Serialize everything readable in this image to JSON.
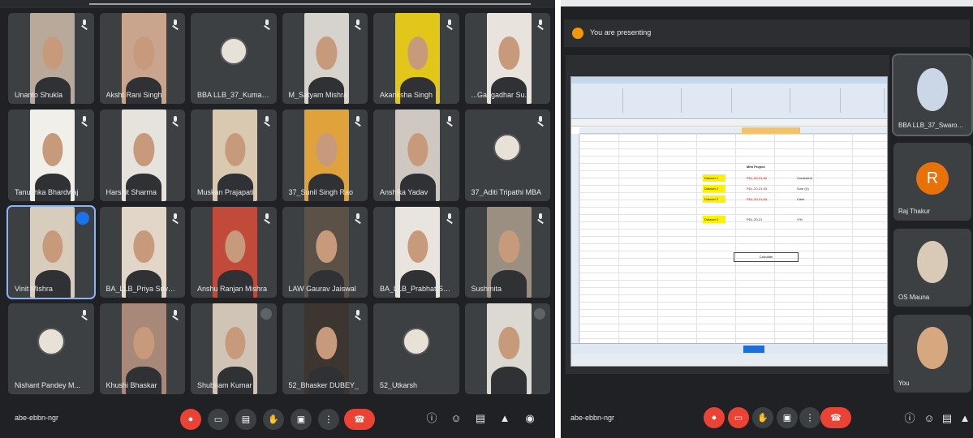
{
  "left": {
    "participants": [
      {
        "name": "Unanto Shukla",
        "cam": "#b9a99b",
        "mic": true
      },
      {
        "name": "Aksht Rani Singh",
        "cam": "#caa58d",
        "mic": true
      },
      {
        "name": "BBA LLB_37_Kumar...",
        "cam": "avatar",
        "mic": true
      },
      {
        "name": "M_Satyam Mishra",
        "cam": "#d6d3cc",
        "mic": true
      },
      {
        "name": "Akanksha Singh",
        "cam": "#e3c61a",
        "mic": true
      },
      {
        "name": "...Gangadhar Su...",
        "cam": "#e8e3dc",
        "mic": true
      },
      {
        "name": "Tanushka Bhardwaj",
        "cam": "#f1efe9",
        "mic": true
      },
      {
        "name": "Harshit Sharma",
        "cam": "#e6e2dc",
        "mic": true
      },
      {
        "name": "Muskan Prajapati",
        "cam": "#d9c9b0",
        "mic": true
      },
      {
        "name": "37_Sunil Singh Rao",
        "cam": "#e0a23a",
        "mic": true
      },
      {
        "name": "Anshika Yadav",
        "cam": "#cfc8c0",
        "mic": true
      },
      {
        "name": "37_Aditi Tripathi MBA",
        "cam": "avatar",
        "mic": true
      },
      {
        "name": "Vinit Mishra",
        "cam": "#d8cdbd",
        "mic": false,
        "speaking": true,
        "active": true
      },
      {
        "name": "BA_LLB_Priya Srivast...",
        "cam": "#e1d6c7",
        "mic": true
      },
      {
        "name": "Anshu Ranjan Mishra",
        "cam": "#c14a3a",
        "mic": true
      },
      {
        "name": "LAW Gaurav Jaiswal",
        "cam": "#5c5146",
        "mic": true
      },
      {
        "name": "BA_LLB_Prabhat Sh...",
        "cam": "#e9e4dd",
        "mic": true
      },
      {
        "name": "Sushmita",
        "cam": "#9b8f82",
        "mic": true
      },
      {
        "name": "Nishant Pandey M...",
        "cam": "avatar",
        "mic": true
      },
      {
        "name": "Khushi Bhaskar",
        "cam": "#a88878",
        "mic": true
      },
      {
        "name": "Shubham Kumar",
        "cam": "#cfc4b5",
        "mic": false,
        "more": true
      },
      {
        "name": "52_Bhasker DUBEY_",
        "cam": "#3d3630",
        "mic": true
      },
      {
        "name": "52_Utkarsh",
        "cam": "avatar",
        "mic": false
      },
      {
        "name": "",
        "cam": "#dcd9d2",
        "mic": false,
        "more": true
      }
    ],
    "meeting_code": "abe-ebbn-ngr"
  },
  "right": {
    "presenting_label": "You are presenting",
    "meeting_code": "abe-ebbn-ngr",
    "side_tiles": [
      {
        "name": "BBA LLB_37_Swaroop Mishra",
        "kind": "cam",
        "cam": "#cbd6e6"
      },
      {
        "name": "Raj Thakur",
        "kind": "letter",
        "letter": "R"
      },
      {
        "name": "OS Mauna",
        "kind": "cam",
        "cam": "#d9cab7"
      },
      {
        "name": "You",
        "kind": "cam",
        "cam": "#d7a77f"
      }
    ],
    "sheet": {
      "heading": "Mini Project",
      "rows": [
        {
          "label": "Dataset 1",
          "value": "PDL-20-21-52",
          "note": "Consistent"
        },
        {
          "label": "Dataset 2",
          "value": "PDL-20-21-53",
          "note": "Sum (X)"
        },
        {
          "label": "Dataset 3",
          "value": "PDL-20-21-54",
          "note": "Cash"
        },
        {
          "label": "Dataset 4",
          "value": "PDL-20-21",
          "note": "Y/N"
        }
      ],
      "button": "Calculate"
    }
  },
  "colors": {
    "meet_bg": "#202124",
    "tile_bg": "#3c4043",
    "end_call": "#ea4335",
    "accent": "#1a73e8",
    "present_dot": "#f29900"
  }
}
